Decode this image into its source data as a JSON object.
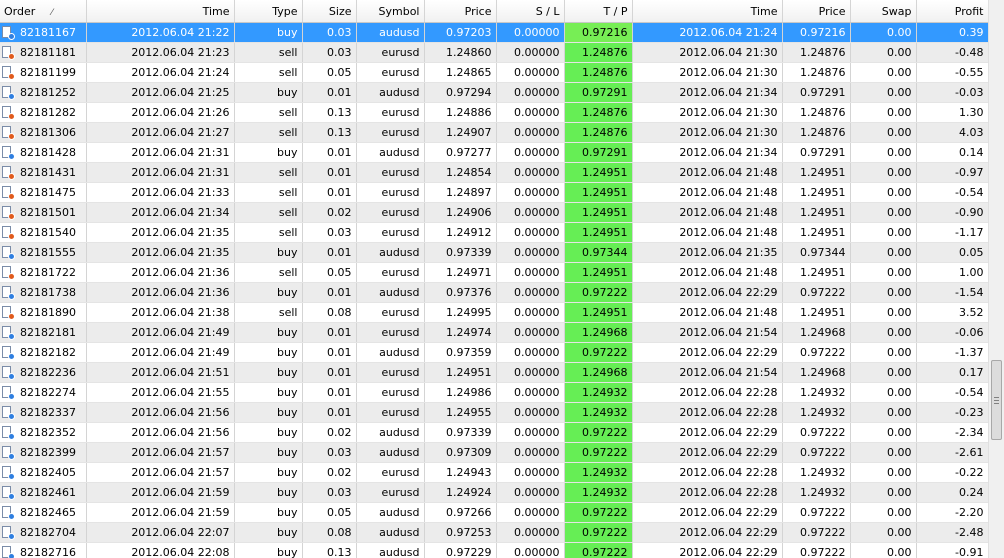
{
  "columns": {
    "order": "Order",
    "sort_indicator": "⁄",
    "time": "Time",
    "type": "Type",
    "size": "Size",
    "symbol": "Symbol",
    "price": "Price",
    "sl": "S / L",
    "tp": "T / P",
    "close_time": "Time",
    "close_price": "Price",
    "swap": "Swap",
    "profit": "Profit"
  },
  "colors": {
    "selected_row": "#3399ff",
    "tp_highlight": "#66ee55",
    "alt_row": "#ececec"
  },
  "rows": [
    {
      "order": "82181167",
      "time": "2012.06.04 21:22",
      "type": "buy",
      "size": "0.03",
      "symbol": "audusd",
      "price": "0.97203",
      "sl": "0.00000",
      "tp": "0.97216",
      "close_time": "2012.06.04 21:24",
      "close_price": "0.97216",
      "swap": "0.00",
      "profit": "0.39",
      "selected": true
    },
    {
      "order": "82181181",
      "time": "2012.06.04 21:23",
      "type": "sell",
      "size": "0.03",
      "symbol": "eurusd",
      "price": "1.24860",
      "sl": "0.00000",
      "tp": "1.24876",
      "close_time": "2012.06.04 21:30",
      "close_price": "1.24876",
      "swap": "0.00",
      "profit": "-0.48"
    },
    {
      "order": "82181199",
      "time": "2012.06.04 21:24",
      "type": "sell",
      "size": "0.05",
      "symbol": "eurusd",
      "price": "1.24865",
      "sl": "0.00000",
      "tp": "1.24876",
      "close_time": "2012.06.04 21:30",
      "close_price": "1.24876",
      "swap": "0.00",
      "profit": "-0.55"
    },
    {
      "order": "82181252",
      "time": "2012.06.04 21:25",
      "type": "buy",
      "size": "0.01",
      "symbol": "audusd",
      "price": "0.97294",
      "sl": "0.00000",
      "tp": "0.97291",
      "close_time": "2012.06.04 21:34",
      "close_price": "0.97291",
      "swap": "0.00",
      "profit": "-0.03"
    },
    {
      "order": "82181282",
      "time": "2012.06.04 21:26",
      "type": "sell",
      "size": "0.13",
      "symbol": "eurusd",
      "price": "1.24886",
      "sl": "0.00000",
      "tp": "1.24876",
      "close_time": "2012.06.04 21:30",
      "close_price": "1.24876",
      "swap": "0.00",
      "profit": "1.30"
    },
    {
      "order": "82181306",
      "time": "2012.06.04 21:27",
      "type": "sell",
      "size": "0.13",
      "symbol": "eurusd",
      "price": "1.24907",
      "sl": "0.00000",
      "tp": "1.24876",
      "close_time": "2012.06.04 21:30",
      "close_price": "1.24876",
      "swap": "0.00",
      "profit": "4.03"
    },
    {
      "order": "82181428",
      "time": "2012.06.04 21:31",
      "type": "buy",
      "size": "0.01",
      "symbol": "audusd",
      "price": "0.97277",
      "sl": "0.00000",
      "tp": "0.97291",
      "close_time": "2012.06.04 21:34",
      "close_price": "0.97291",
      "swap": "0.00",
      "profit": "0.14"
    },
    {
      "order": "82181431",
      "time": "2012.06.04 21:31",
      "type": "sell",
      "size": "0.01",
      "symbol": "eurusd",
      "price": "1.24854",
      "sl": "0.00000",
      "tp": "1.24951",
      "close_time": "2012.06.04 21:48",
      "close_price": "1.24951",
      "swap": "0.00",
      "profit": "-0.97"
    },
    {
      "order": "82181475",
      "time": "2012.06.04 21:33",
      "type": "sell",
      "size": "0.01",
      "symbol": "eurusd",
      "price": "1.24897",
      "sl": "0.00000",
      "tp": "1.24951",
      "close_time": "2012.06.04 21:48",
      "close_price": "1.24951",
      "swap": "0.00",
      "profit": "-0.54"
    },
    {
      "order": "82181501",
      "time": "2012.06.04 21:34",
      "type": "sell",
      "size": "0.02",
      "symbol": "eurusd",
      "price": "1.24906",
      "sl": "0.00000",
      "tp": "1.24951",
      "close_time": "2012.06.04 21:48",
      "close_price": "1.24951",
      "swap": "0.00",
      "profit": "-0.90"
    },
    {
      "order": "82181540",
      "time": "2012.06.04 21:35",
      "type": "sell",
      "size": "0.03",
      "symbol": "eurusd",
      "price": "1.24912",
      "sl": "0.00000",
      "tp": "1.24951",
      "close_time": "2012.06.04 21:48",
      "close_price": "1.24951",
      "swap": "0.00",
      "profit": "-1.17"
    },
    {
      "order": "82181555",
      "time": "2012.06.04 21:35",
      "type": "buy",
      "size": "0.01",
      "symbol": "audusd",
      "price": "0.97339",
      "sl": "0.00000",
      "tp": "0.97344",
      "close_time": "2012.06.04 21:35",
      "close_price": "0.97344",
      "swap": "0.00",
      "profit": "0.05"
    },
    {
      "order": "82181722",
      "time": "2012.06.04 21:36",
      "type": "sell",
      "size": "0.05",
      "symbol": "eurusd",
      "price": "1.24971",
      "sl": "0.00000",
      "tp": "1.24951",
      "close_time": "2012.06.04 21:48",
      "close_price": "1.24951",
      "swap": "0.00",
      "profit": "1.00"
    },
    {
      "order": "82181738",
      "time": "2012.06.04 21:36",
      "type": "buy",
      "size": "0.01",
      "symbol": "audusd",
      "price": "0.97376",
      "sl": "0.00000",
      "tp": "0.97222",
      "close_time": "2012.06.04 22:29",
      "close_price": "0.97222",
      "swap": "0.00",
      "profit": "-1.54"
    },
    {
      "order": "82181890",
      "time": "2012.06.04 21:38",
      "type": "sell",
      "size": "0.08",
      "symbol": "eurusd",
      "price": "1.24995",
      "sl": "0.00000",
      "tp": "1.24951",
      "close_time": "2012.06.04 21:48",
      "close_price": "1.24951",
      "swap": "0.00",
      "profit": "3.52"
    },
    {
      "order": "82182181",
      "time": "2012.06.04 21:49",
      "type": "buy",
      "size": "0.01",
      "symbol": "eurusd",
      "price": "1.24974",
      "sl": "0.00000",
      "tp": "1.24968",
      "close_time": "2012.06.04 21:54",
      "close_price": "1.24968",
      "swap": "0.00",
      "profit": "-0.06"
    },
    {
      "order": "82182182",
      "time": "2012.06.04 21:49",
      "type": "buy",
      "size": "0.01",
      "symbol": "audusd",
      "price": "0.97359",
      "sl": "0.00000",
      "tp": "0.97222",
      "close_time": "2012.06.04 22:29",
      "close_price": "0.97222",
      "swap": "0.00",
      "profit": "-1.37"
    },
    {
      "order": "82182236",
      "time": "2012.06.04 21:51",
      "type": "buy",
      "size": "0.01",
      "symbol": "eurusd",
      "price": "1.24951",
      "sl": "0.00000",
      "tp": "1.24968",
      "close_time": "2012.06.04 21:54",
      "close_price": "1.24968",
      "swap": "0.00",
      "profit": "0.17"
    },
    {
      "order": "82182274",
      "time": "2012.06.04 21:55",
      "type": "buy",
      "size": "0.01",
      "symbol": "eurusd",
      "price": "1.24986",
      "sl": "0.00000",
      "tp": "1.24932",
      "close_time": "2012.06.04 22:28",
      "close_price": "1.24932",
      "swap": "0.00",
      "profit": "-0.54"
    },
    {
      "order": "82182337",
      "time": "2012.06.04 21:56",
      "type": "buy",
      "size": "0.01",
      "symbol": "eurusd",
      "price": "1.24955",
      "sl": "0.00000",
      "tp": "1.24932",
      "close_time": "2012.06.04 22:28",
      "close_price": "1.24932",
      "swap": "0.00",
      "profit": "-0.23"
    },
    {
      "order": "82182352",
      "time": "2012.06.04 21:56",
      "type": "buy",
      "size": "0.02",
      "symbol": "audusd",
      "price": "0.97339",
      "sl": "0.00000",
      "tp": "0.97222",
      "close_time": "2012.06.04 22:29",
      "close_price": "0.97222",
      "swap": "0.00",
      "profit": "-2.34"
    },
    {
      "order": "82182399",
      "time": "2012.06.04 21:57",
      "type": "buy",
      "size": "0.03",
      "symbol": "audusd",
      "price": "0.97309",
      "sl": "0.00000",
      "tp": "0.97222",
      "close_time": "2012.06.04 22:29",
      "close_price": "0.97222",
      "swap": "0.00",
      "profit": "-2.61"
    },
    {
      "order": "82182405",
      "time": "2012.06.04 21:57",
      "type": "buy",
      "size": "0.02",
      "symbol": "eurusd",
      "price": "1.24943",
      "sl": "0.00000",
      "tp": "1.24932",
      "close_time": "2012.06.04 22:28",
      "close_price": "1.24932",
      "swap": "0.00",
      "profit": "-0.22"
    },
    {
      "order": "82182461",
      "time": "2012.06.04 21:59",
      "type": "buy",
      "size": "0.03",
      "symbol": "eurusd",
      "price": "1.24924",
      "sl": "0.00000",
      "tp": "1.24932",
      "close_time": "2012.06.04 22:28",
      "close_price": "1.24932",
      "swap": "0.00",
      "profit": "0.24"
    },
    {
      "order": "82182465",
      "time": "2012.06.04 21:59",
      "type": "buy",
      "size": "0.05",
      "symbol": "audusd",
      "price": "0.97266",
      "sl": "0.00000",
      "tp": "0.97222",
      "close_time": "2012.06.04 22:29",
      "close_price": "0.97222",
      "swap": "0.00",
      "profit": "-2.20"
    },
    {
      "order": "82182704",
      "time": "2012.06.04 22:07",
      "type": "buy",
      "size": "0.08",
      "symbol": "audusd",
      "price": "0.97253",
      "sl": "0.00000",
      "tp": "0.97222",
      "close_time": "2012.06.04 22:29",
      "close_price": "0.97222",
      "swap": "0.00",
      "profit": "-2.48"
    },
    {
      "order": "82182716",
      "time": "2012.06.04 22:08",
      "type": "buy",
      "size": "0.13",
      "symbol": "audusd",
      "price": "0.97229",
      "sl": "0.00000",
      "tp": "0.97222",
      "close_time": "2012.06.04 22:29",
      "close_price": "0.97222",
      "swap": "0.00",
      "profit": "-0.91"
    }
  ]
}
